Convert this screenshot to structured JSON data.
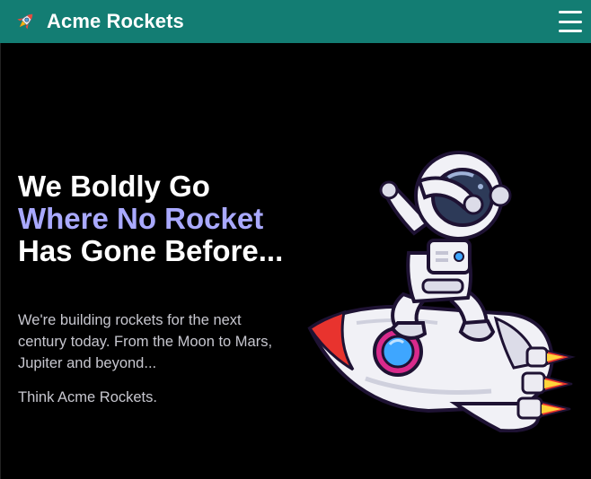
{
  "header": {
    "brand_name": "Acme Rockets",
    "brand_icon": "rocket-icon",
    "menu_icon": "hamburger-menu-icon",
    "background": "#137d73"
  },
  "hero": {
    "title_part1": "We Boldly Go ",
    "title_accent": "Where No Rocket",
    "title_part2": " Has Gone Before...",
    "accent_color": "#a9a9ff",
    "description": "We're building rockets for the next century today. From the Moon to Mars, Jupiter and beyond...",
    "tagline": "Think Acme Rockets.",
    "illustration": "astronaut-on-rocket-illustration"
  }
}
